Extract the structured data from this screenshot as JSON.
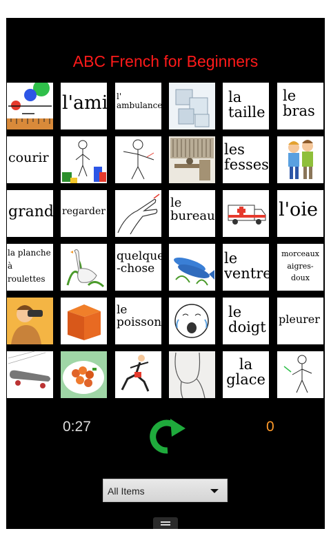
{
  "title": "ABC French for Beginners",
  "tiles": [
    {
      "type": "image",
      "icon": "rainbow-ruler-image"
    },
    {
      "type": "word",
      "text": "l'ami"
    },
    {
      "type": "word",
      "text": "l'\nambulance"
    },
    {
      "type": "image",
      "icon": "ice-cubes-image"
    },
    {
      "type": "word",
      "text": "la\ntaille"
    },
    {
      "type": "word",
      "text": "le\nbras"
    },
    {
      "type": "word",
      "text": "courir"
    },
    {
      "type": "image",
      "icon": "person-with-blocks-image"
    },
    {
      "type": "image",
      "icon": "stick-figure-arm-image"
    },
    {
      "type": "image",
      "icon": "study-room-image"
    },
    {
      "type": "word",
      "text": "les\nfesses"
    },
    {
      "type": "image",
      "icon": "friends-image"
    },
    {
      "type": "word",
      "text": "grand"
    },
    {
      "type": "word",
      "text": "regarder"
    },
    {
      "type": "image",
      "icon": "hand-pointing-image"
    },
    {
      "type": "word",
      "text": "le\nbureau"
    },
    {
      "type": "image",
      "icon": "ambulance-image"
    },
    {
      "type": "word",
      "text": "l'oie"
    },
    {
      "type": "word",
      "text": "la planche\nà\nroulettes"
    },
    {
      "type": "image",
      "icon": "goose-image"
    },
    {
      "type": "word",
      "text": "quelque\n-chose"
    },
    {
      "type": "image",
      "icon": "fish-image"
    },
    {
      "type": "word",
      "text": "le\nventre"
    },
    {
      "type": "word",
      "text": "morceaux\naigres-\ndoux"
    },
    {
      "type": "image",
      "icon": "binoculars-man-image"
    },
    {
      "type": "image",
      "icon": "box-image"
    },
    {
      "type": "word",
      "text": "le\npoisson"
    },
    {
      "type": "image",
      "icon": "crying-face-image"
    },
    {
      "type": "word",
      "text": "le\ndoigt"
    },
    {
      "type": "word",
      "text": "pleurer"
    },
    {
      "type": "image",
      "icon": "skateboard-image"
    },
    {
      "type": "image",
      "icon": "sweet-sour-dish-image"
    },
    {
      "type": "image",
      "icon": "runner-image"
    },
    {
      "type": "image",
      "icon": "buttocks-sketch-image"
    },
    {
      "type": "word",
      "text": "la\nglace"
    },
    {
      "type": "image",
      "icon": "stick-figure-pointing-image"
    }
  ],
  "timer": "0:27",
  "score": "0",
  "dropdown": {
    "selected": "All Items"
  },
  "colors": {
    "title": "#ff1a1a",
    "score": "#ff9a2a",
    "refresh": "#1faa3c",
    "background": "#000000"
  }
}
